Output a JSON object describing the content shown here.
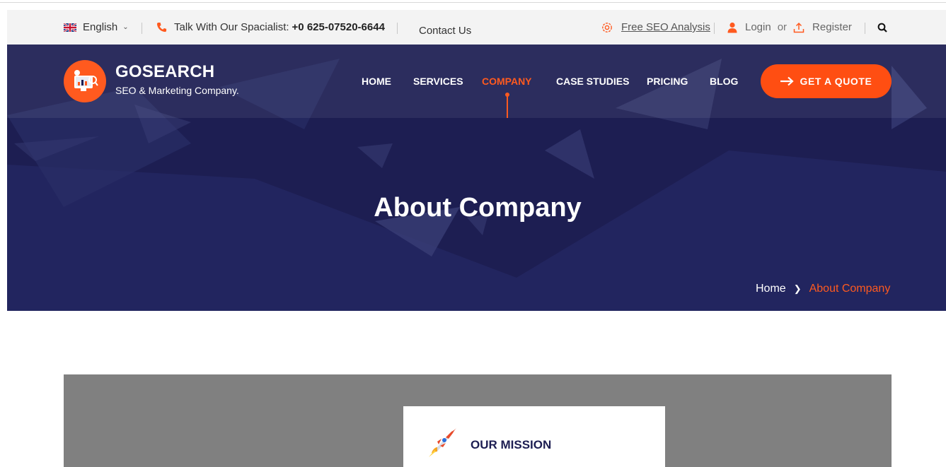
{
  "topbar": {
    "language": "English",
    "phone_prefix": "Talk With Our Spacialist:",
    "phone_number": "+0 625-07520-6644",
    "contact": "Contact Us",
    "seo_link": "Free SEO Analysis",
    "login": "Login",
    "or": "or",
    "register": "Register"
  },
  "brand": {
    "name": "GOSEARCH",
    "tagline": "SEO & Marketing Company."
  },
  "nav": {
    "items": [
      "HOME",
      "SERVICES",
      "COMPANY",
      "CASE STUDIES",
      "PRICING",
      "BLOG"
    ],
    "active": "COMPANY",
    "cta": "GET A QUOTE"
  },
  "hero": {
    "title": "About Company",
    "breadcrumb_home": "Home",
    "breadcrumb_current": "About Company"
  },
  "content": {
    "mission_label": "OUR MISSION"
  },
  "colors": {
    "accent": "#ff5a1f",
    "navy": "#1d1e52",
    "topbar_bg": "#f3f3f3"
  },
  "icons": [
    "uk-flag-icon",
    "chevron-down-icon",
    "phone-icon",
    "seo-analysis-icon",
    "user-icon",
    "upload-icon",
    "search-icon",
    "arrow-right-icon",
    "rocket-icon"
  ]
}
